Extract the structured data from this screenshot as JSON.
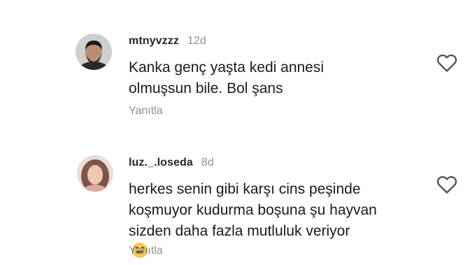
{
  "comments": [
    {
      "username": "mtnyvzzz",
      "time": "12d",
      "lines": [
        "Kanka genç yaşta kedi annesi",
        "olmuşsun bile. Bol şans"
      ],
      "reply_label": "Yanıtla",
      "like_icon": "heart-outline-icon"
    },
    {
      "username": "luz._.loseda",
      "time": "8d",
      "lines": [
        "herkes senin gibi karşı cins peşinde",
        "koşmuyor kudurma boşuna şu hayvan",
        "sizden daha fazla mutluluk veriyor"
      ],
      "emoji": "😂",
      "reply_label": "Yanıtla",
      "like_icon": "heart-outline-icon"
    }
  ],
  "colors": {
    "username": "#262626",
    "meta": "#8e8e8e",
    "text": "#1a1a1a",
    "background": "#ffffff"
  }
}
